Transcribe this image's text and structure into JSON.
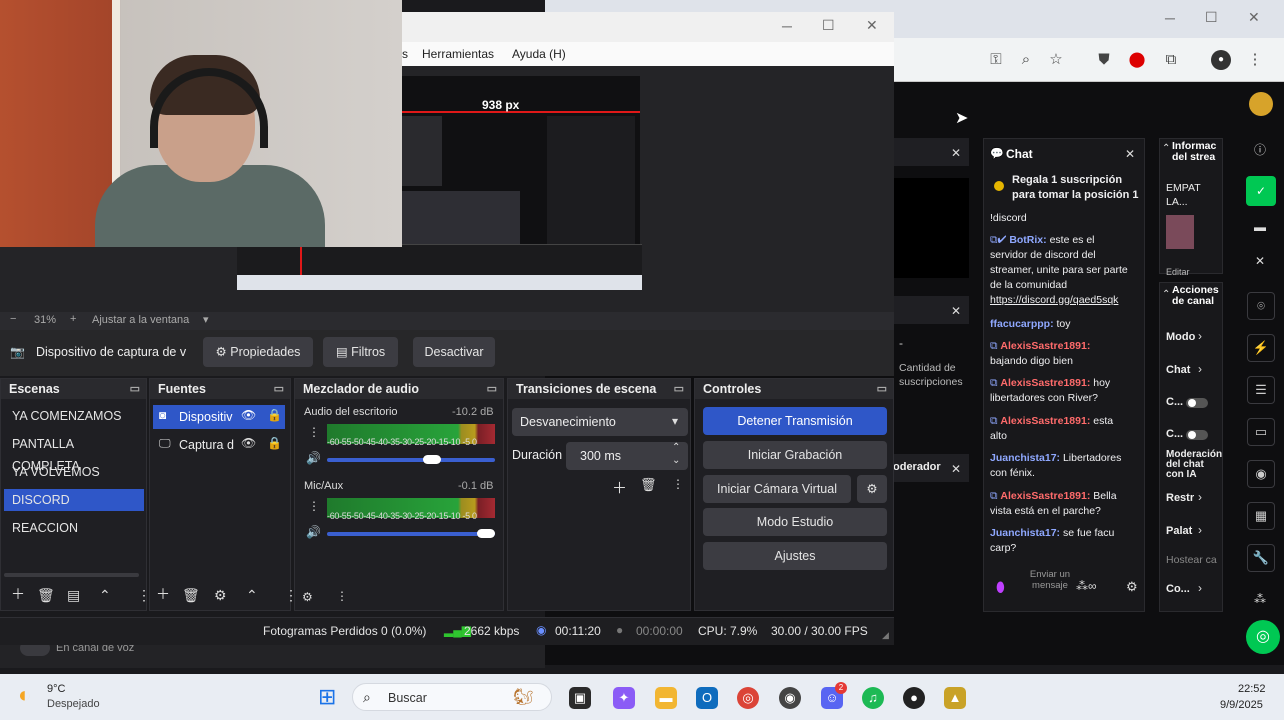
{
  "obs": {
    "menu": [
      "s",
      "Herramientas",
      "Ayuda (H)"
    ],
    "preview_overlay_text": "938 px",
    "zoom": {
      "minus": "−",
      "value": "31%",
      "plus": "+",
      "fit_label": "Ajustar a la ventana"
    },
    "source_bar": {
      "selected_source": "Dispositivo de captura de v",
      "properties": "Propiedades",
      "filters": "Filtros",
      "deactivate": "Desactivar"
    },
    "docks": {
      "scenes": {
        "title": "Escenas",
        "items": [
          "YA COMENZAMOS",
          "PANTALLA COMPLETA",
          "YA VOLVEMOS",
          "DISCORD",
          "REACCION"
        ],
        "selected": "DISCORD"
      },
      "sources": {
        "title": "Fuentes",
        "items": [
          "Dispositiv",
          "Captura d"
        ]
      },
      "mixer": {
        "title": "Mezclador de audio",
        "channels": [
          {
            "name": "Audio del escritorio",
            "db": "-10.2 dB"
          },
          {
            "name": "Mic/Aux",
            "db": "-0.1 dB"
          }
        ],
        "scale": "-60-55-50-45-40-35-30-25-20-15-10 -5  0"
      },
      "transitions": {
        "title": "Transiciones de escena",
        "selected": "Desvanecimiento",
        "duration_label": "Duración",
        "duration_value": "300 ms"
      },
      "controls": {
        "title": "Controles",
        "buttons": [
          "Detener Transmisión",
          "Iniciar Grabación",
          "Iniciar Cámara Virtual",
          "Modo Estudio",
          "Ajustes"
        ]
      }
    },
    "status": {
      "dropped": "Fotogramas Perdidos 0 (0.0%)",
      "bitrate": "2662 kbps",
      "live_time": "00:11:20",
      "rec_time": "00:00:00",
      "cpu": "CPU: 7.9%",
      "fps": "30.00 / 30.00 FPS"
    }
  },
  "twitch": {
    "chat_title": "Chat",
    "info_title": "Informac del strea",
    "info_text": "EMPAT LA...",
    "info_sub": "Editar",
    "actions_title": "Acciones de canal",
    "actions": [
      "Modo",
      "Chat",
      "C...",
      "C...",
      "Moderación del chat con IA",
      "Restr",
      "Palat",
      "Hostear ca",
      "Co..."
    ],
    "sub_goal": "Regala 1 suscripción para tomar la posición 1",
    "sub_qty": "Cantidad de suscripciones",
    "moderator_label": "oderador",
    "messages": [
      {
        "user": "",
        "text": "!discord"
      },
      {
        "user": "BotRix:",
        "text": " este es el servidor de discord del streamer, unite para ser parte de la comunidad ",
        "link": "https://discord.gg/qaed5sqk"
      },
      {
        "user": "ffacucarppp:",
        "text": " toy"
      },
      {
        "user": "AlexisSastre1891:",
        "text": " bajando digo bien"
      },
      {
        "user": "AlexisSastre1891:",
        "text": " hoy libertadores con River?"
      },
      {
        "user": "AlexisSastre1891:",
        "text": " esta alto"
      },
      {
        "user": "Juanchista17:",
        "text": " Libertadores con fénix."
      },
      {
        "user": "AlexisSastre1891:",
        "text": " Bella vista está en el parche?"
      },
      {
        "user": "Juanchista17:",
        "text": " se fue facu carp?"
      }
    ],
    "input_placeholder": "Enviar un mensaje",
    "discord_label": "En canal de voz"
  },
  "taskbar": {
    "weather_temp": "9°C",
    "weather_desc": "Despejado",
    "search": "Buscar",
    "time": "22:52",
    "date": "9/9/2025",
    "discord_badge": "2"
  },
  "colors": {
    "accent": "#2f57c8",
    "twitch_purple": "#9147ff",
    "green": "#00c853"
  }
}
